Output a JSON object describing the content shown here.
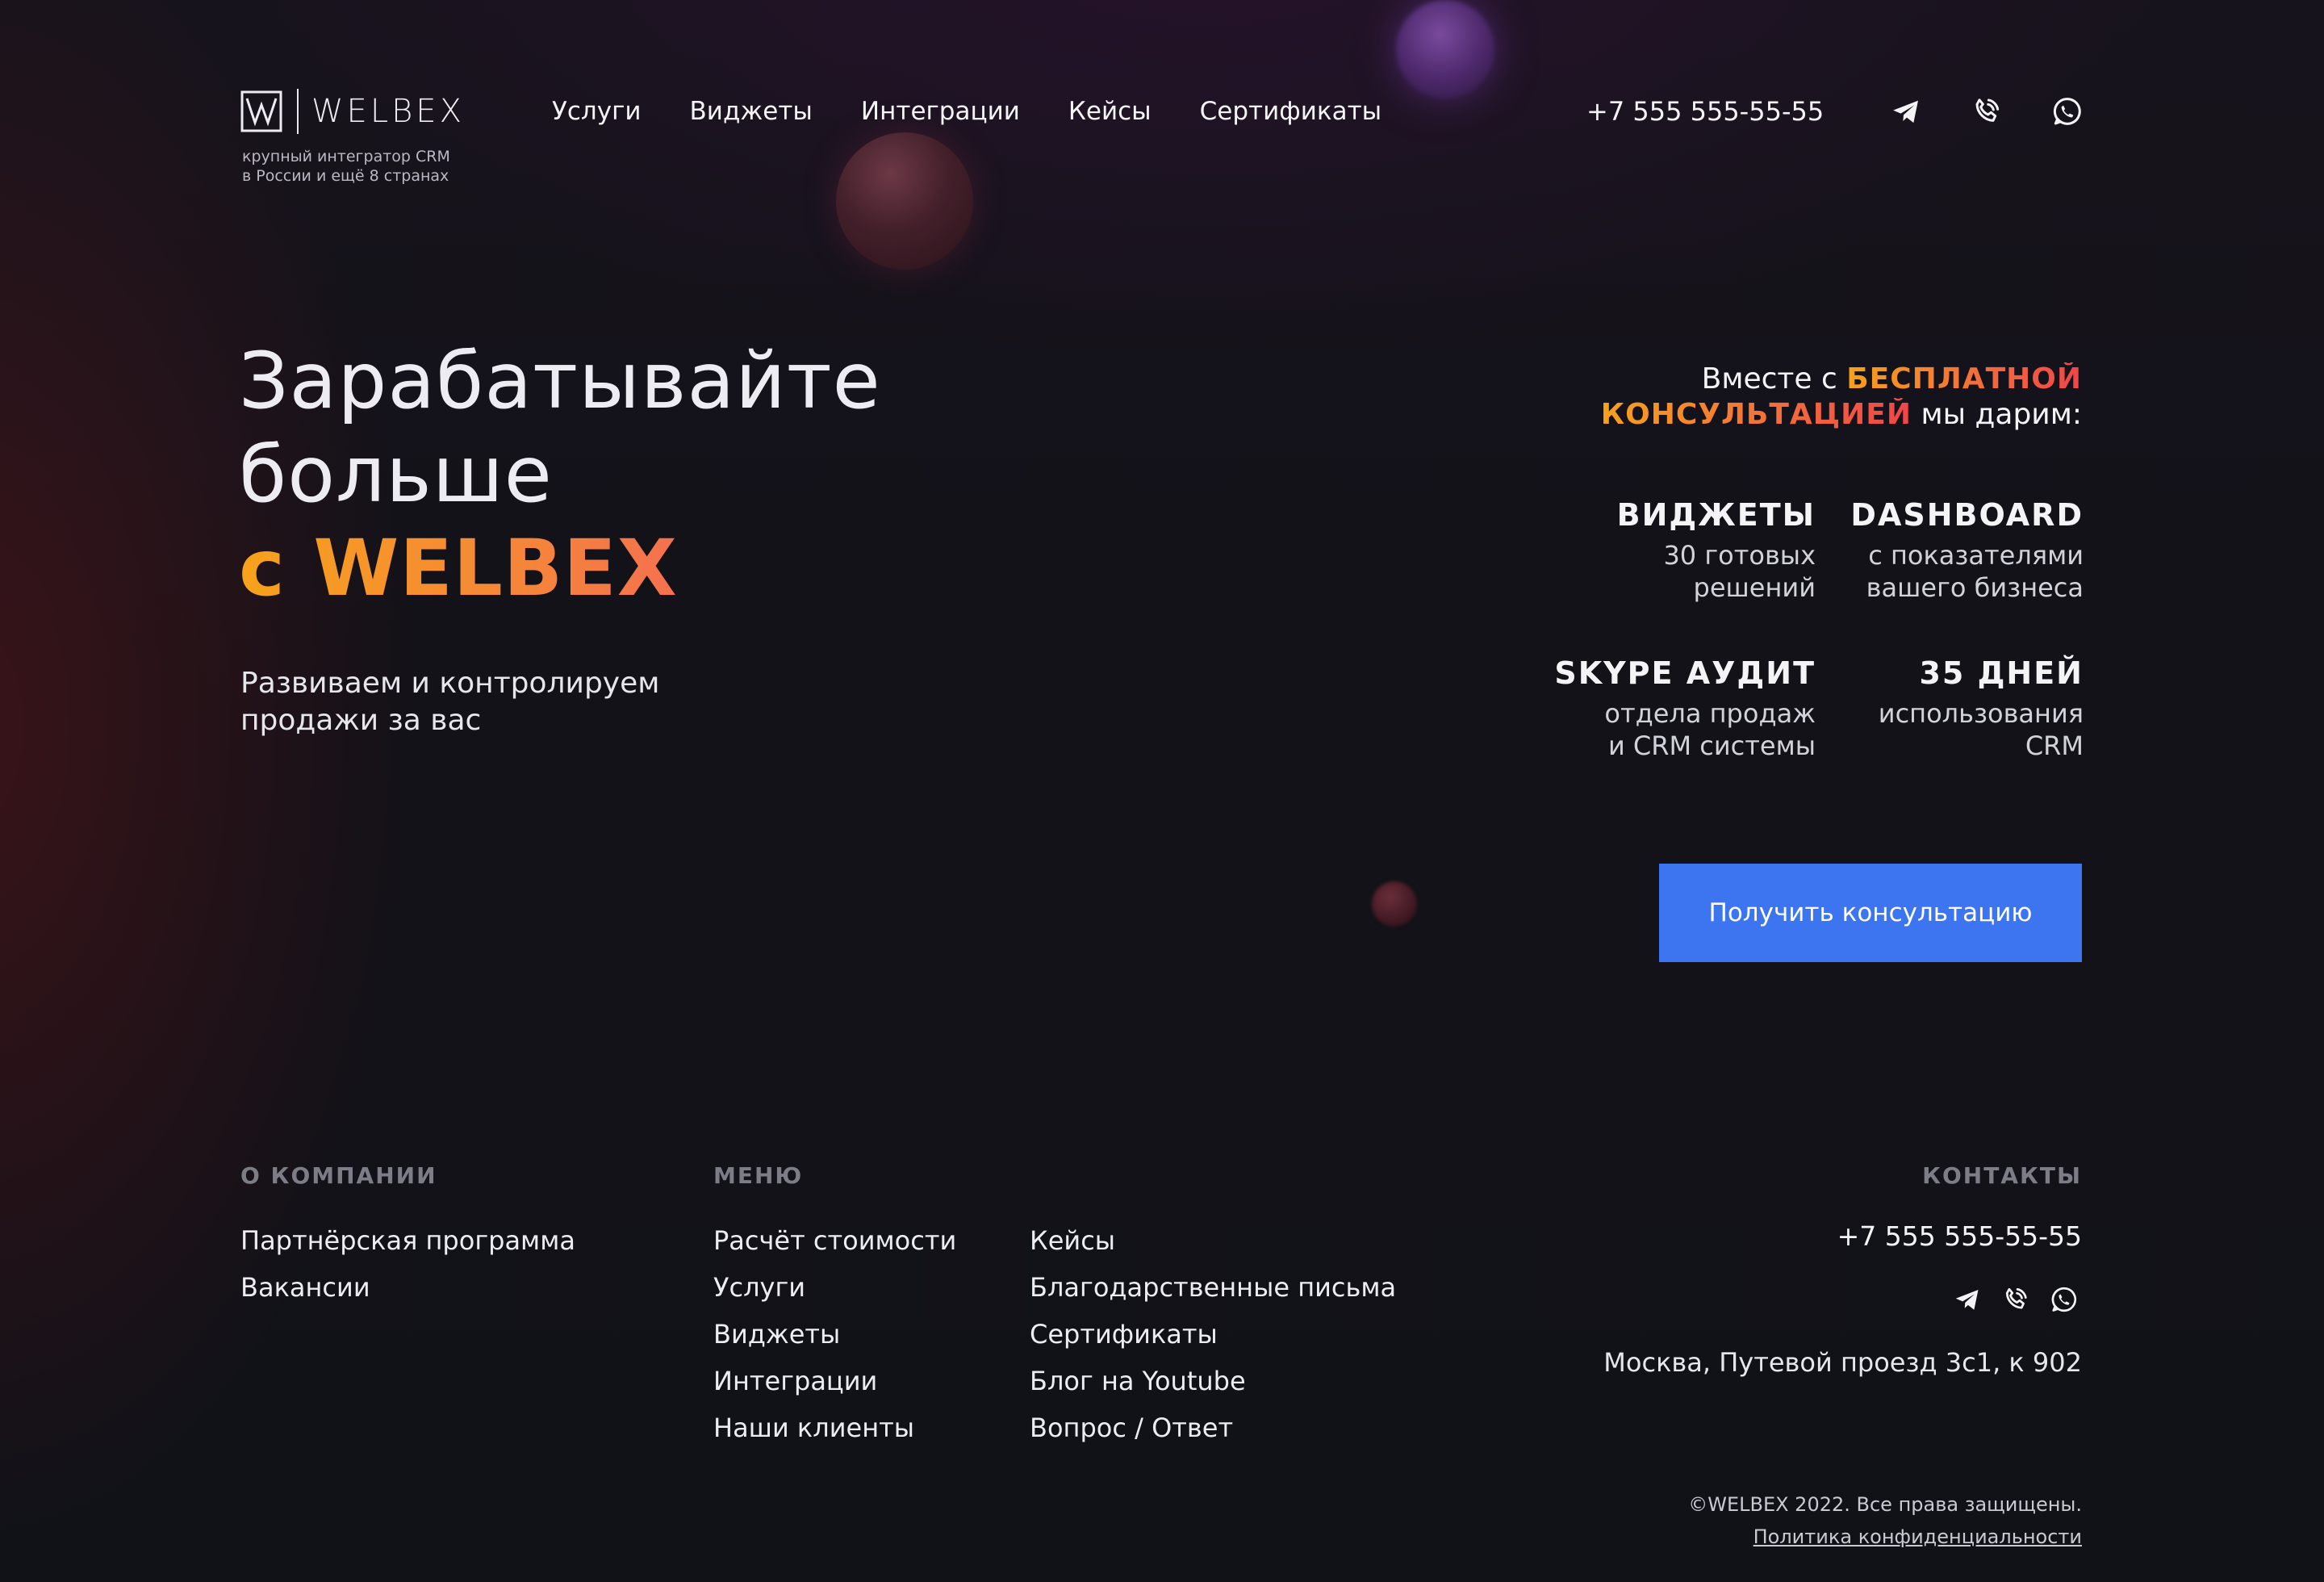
{
  "brand": {
    "name": "WELBEX",
    "tagline_line1": "крупный интегратор CRM",
    "tagline_line2": "в России и ещё 8 странах"
  },
  "nav": {
    "items": [
      {
        "label": "Услуги"
      },
      {
        "label": "Виджеты"
      },
      {
        "label": "Интеграции"
      },
      {
        "label": "Кейсы"
      },
      {
        "label": "Сертификаты"
      }
    ]
  },
  "header": {
    "phone": "+7 555 555-55-55",
    "icons": [
      "telegram-icon",
      "phone-icon",
      "whatsapp-icon"
    ]
  },
  "hero": {
    "title_line1": "Зарабатывайте",
    "title_line2": "больше",
    "title_accent": "с WELBEX",
    "subtitle_line1": "Развиваем и контролируем",
    "subtitle_line2": "продажи за вас"
  },
  "offer": {
    "intro_prefix": "Вместе с ",
    "intro_highlight_1": "БЕСПЛАТНОЙ",
    "intro_highlight_2": "КОНСУЛЬТАЦИЕЙ",
    "intro_suffix": " мы дарим:",
    "features": [
      {
        "title": "ВИДЖЕТЫ",
        "desc_line1": "30 готовых",
        "desc_line2": "решений"
      },
      {
        "title": "DASHBOARD",
        "desc_line1": "с показателями",
        "desc_line2": "вашего бизнеса"
      },
      {
        "title": "SKYPE АУДИТ",
        "desc_line1": "отдела продаж",
        "desc_line2": "и CRM системы"
      },
      {
        "title": "35 ДНЕЙ",
        "desc_line1": "использования",
        "desc_line2": "CRM"
      }
    ],
    "cta_label": "Получить консультацию"
  },
  "footer": {
    "about_heading": "О КОМПАНИИ",
    "about_links": [
      "Партнёрская программа",
      "Вакансии"
    ],
    "menu_heading": "МЕНЮ",
    "menu_col1": [
      "Расчёт стоимости",
      "Услуги",
      "Виджеты",
      "Интеграции",
      "Наши клиенты"
    ],
    "menu_col2": [
      "Кейсы",
      "Благодарственные письма",
      "Сертификаты",
      "Блог на Youtube",
      "Вопрос / Ответ"
    ],
    "contacts_heading": "КОНТАКТЫ",
    "phone": "+7 555 555-55-55",
    "address": "Москва, Путевой проезд 3с1, к 902",
    "copyright": "©WELBEX 2022. Все права защищены.",
    "privacy": "Политика конфиденциальности"
  },
  "colors": {
    "background": "#111218",
    "accent_orange": "#f7a21b",
    "accent_red": "#f04548",
    "cta_blue": "#3d74f0"
  }
}
